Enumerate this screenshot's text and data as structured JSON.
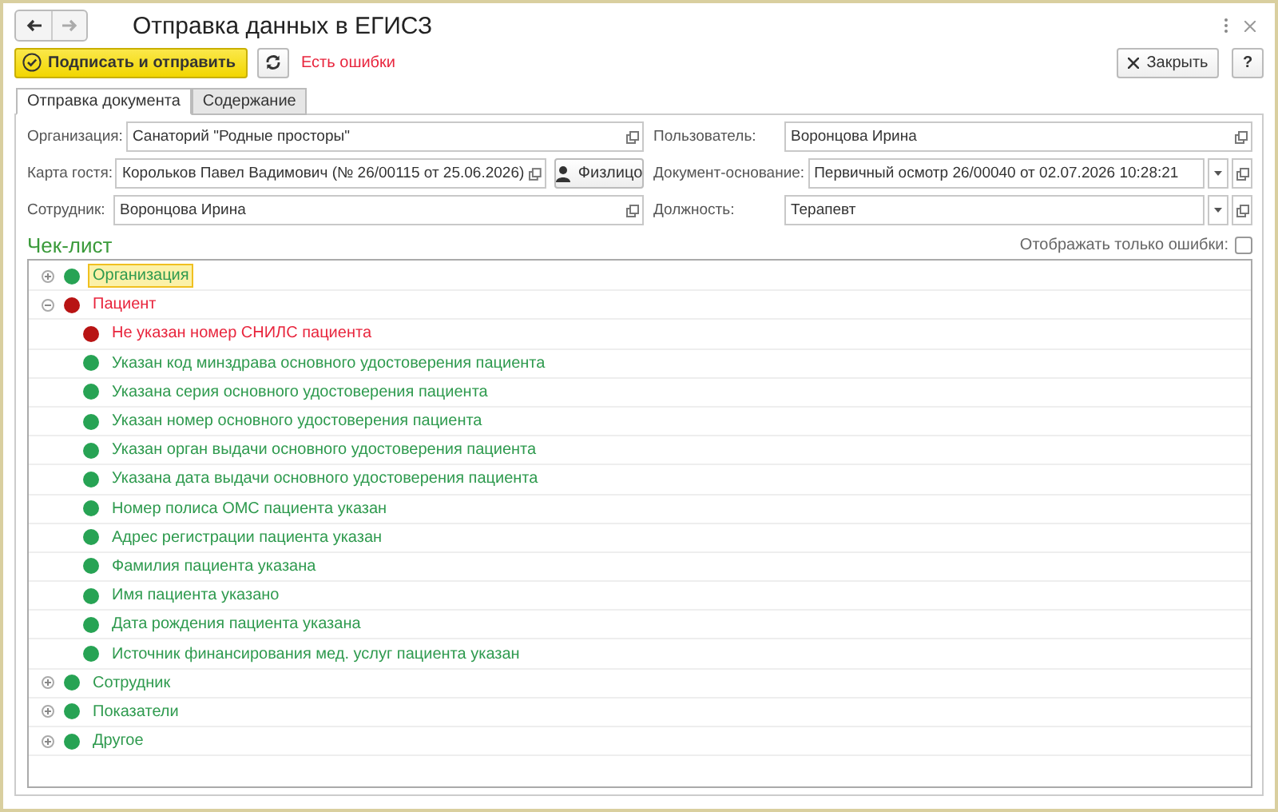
{
  "window": {
    "title": "Отправка данных в ЕГИСЗ"
  },
  "toolbar": {
    "primary_button": "Подписать и отправить",
    "status": "Есть ошибки",
    "close_button": "Закрыть",
    "help_button": "?"
  },
  "tabs": [
    {
      "label": "Отправка документа",
      "selected": true
    },
    {
      "label": "Содержание",
      "selected": false
    }
  ],
  "form_left": [
    {
      "label": "Организация:",
      "value": "Санаторий \"Родные просторы\"",
      "kind": "link"
    },
    {
      "label": "Карта гостя:",
      "value": "Корольков Павел Вадимович (№ 26/00115 от 25.06.2026)",
      "kind": "link",
      "button": "Физлицо"
    },
    {
      "label": "Сотрудник:",
      "value": "Воронцова Ирина",
      "kind": "link"
    }
  ],
  "form_right": [
    {
      "label": "Пользователь:",
      "value": "Воронцова Ирина",
      "kind": "link"
    },
    {
      "label": "Документ-основание:",
      "value": "Первичный осмотр 26/00040 от 02.07.2026 10:28:21",
      "kind": "select"
    },
    {
      "label": "Должность:",
      "value": "Терапевт",
      "kind": "select"
    }
  ],
  "checklist": {
    "title": "Чек-лист",
    "errors_only": {
      "label": "Отображать только ошибки:",
      "checked": false
    },
    "items": [
      {
        "label": "Организация",
        "error": false,
        "expanded": false,
        "selected": true
      },
      {
        "label": "Пациент",
        "error": true,
        "expanded": true,
        "selected": false,
        "children": [
          {
            "label": "Не указан номер СНИЛС пациента",
            "error": true,
            "selected": false
          },
          {
            "label": "Указан код минздрава основного удостоверения пациента",
            "error": false,
            "selected": false
          },
          {
            "label": "Указана серия основного удостоверения пациента",
            "error": false,
            "selected": false
          },
          {
            "label": "Указан номер основного удостоверения пациента",
            "error": false,
            "selected": false
          },
          {
            "label": "Указан орган выдачи основного удостоверения пациента",
            "error": false,
            "selected": false
          },
          {
            "label": "Указана дата выдачи основного удостоверения пациента",
            "error": false,
            "selected": false
          },
          {
            "label": "Номер полиса ОМС пациента указан",
            "error": false,
            "selected": false
          },
          {
            "label": "Адрес регистрации пациента указан",
            "error": false,
            "selected": false
          },
          {
            "label": "Фамилия пациента указана",
            "error": false,
            "selected": false
          },
          {
            "label": "Имя пациента указано",
            "error": false,
            "selected": false
          },
          {
            "label": "Дата рождения пациента указана",
            "error": false,
            "selected": false
          },
          {
            "label": "Источник финансирования мед. услуг пациента указан",
            "error": false,
            "selected": false
          }
        ]
      },
      {
        "label": "Сотрудник",
        "error": false,
        "expanded": false,
        "selected": false
      },
      {
        "label": "Показатели",
        "error": false,
        "expanded": false,
        "selected": false
      },
      {
        "label": "Другое",
        "error": false,
        "expanded": false,
        "selected": false
      }
    ]
  }
}
